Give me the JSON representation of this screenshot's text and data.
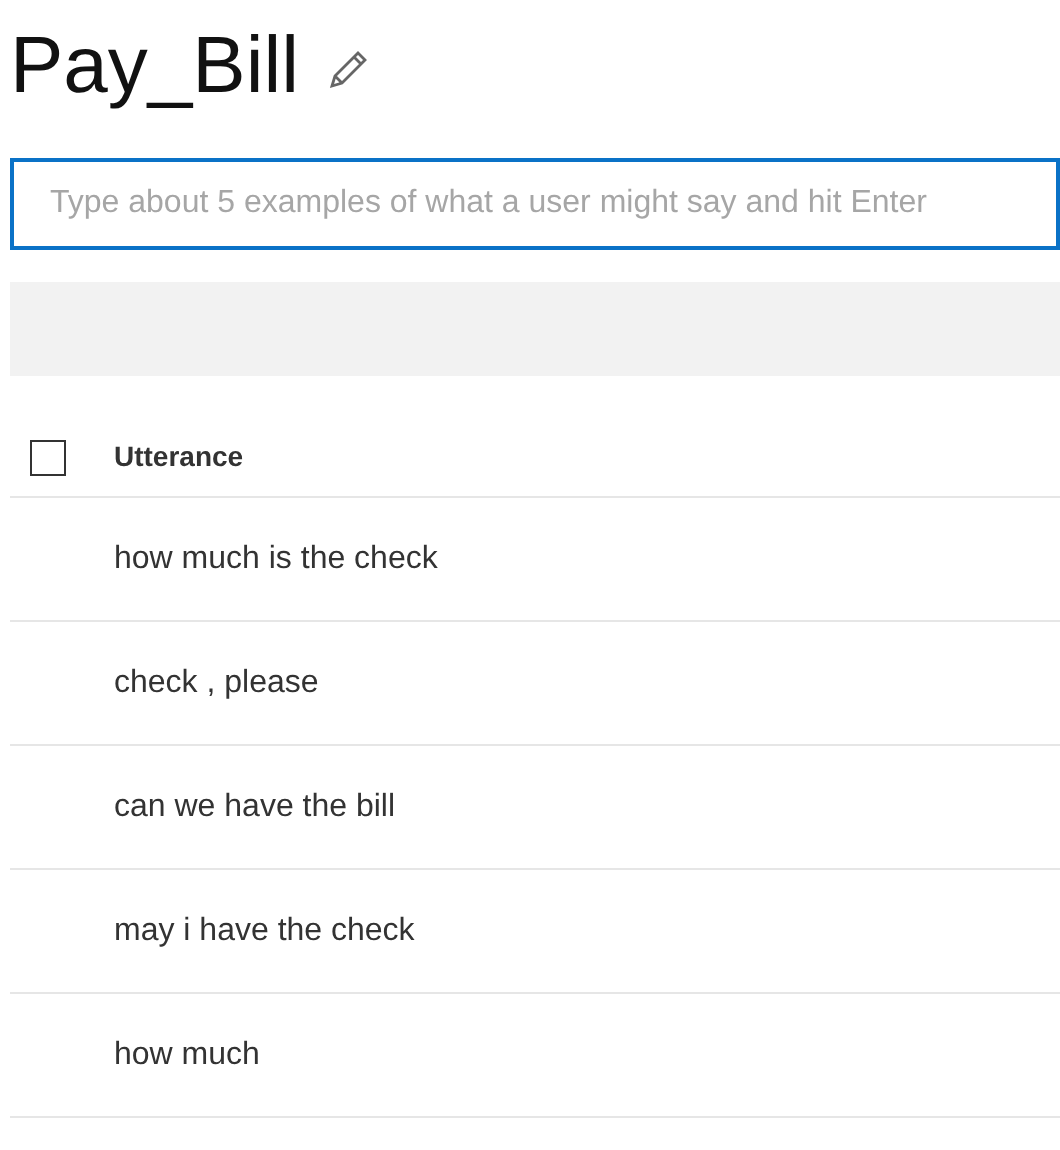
{
  "title": "Pay_Bill",
  "input": {
    "placeholder": "Type about 5 examples of what a user might say and hit Enter"
  },
  "table": {
    "select_all": {
      "checked": false
    },
    "columns": [
      "Utterance"
    ],
    "rows": [
      {
        "utterance": "how much is the check"
      },
      {
        "utterance": "check , please"
      },
      {
        "utterance": "can we have the bill"
      },
      {
        "utterance": "may i have the check"
      },
      {
        "utterance": "how much"
      }
    ]
  }
}
